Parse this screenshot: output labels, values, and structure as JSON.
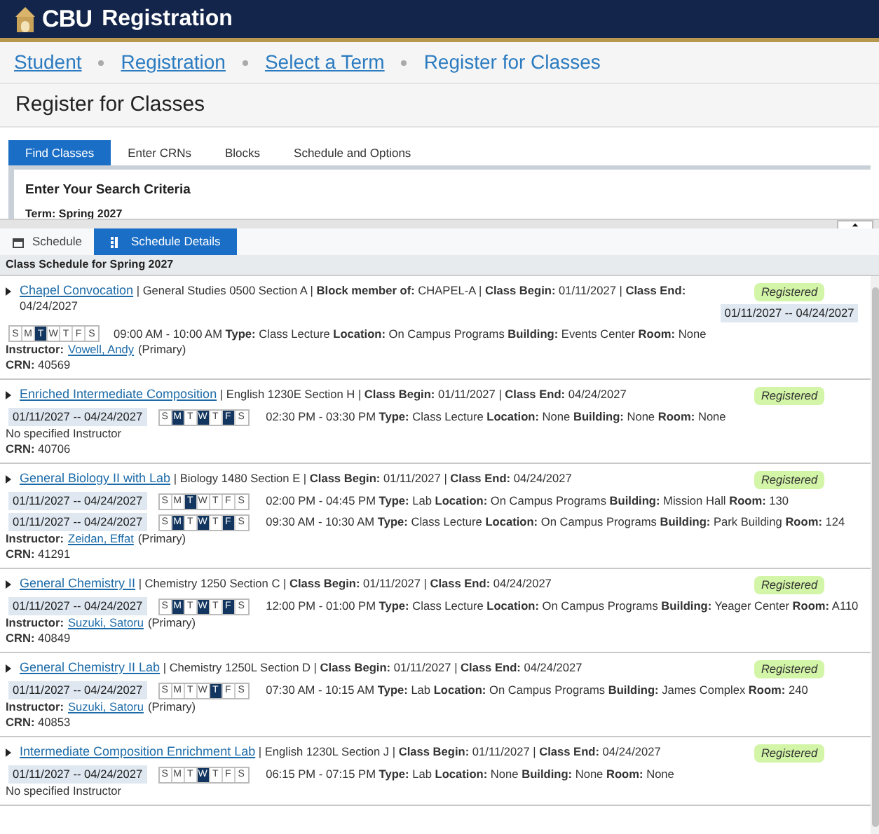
{
  "header": {
    "brand": "CBU",
    "title": "Registration"
  },
  "breadcrumbs": [
    {
      "label": "Student",
      "link": true
    },
    {
      "label": "Registration",
      "link": true
    },
    {
      "label": "Select a Term",
      "link": true
    },
    {
      "label": "Register for Classes",
      "link": false
    }
  ],
  "page_title": "Register for Classes",
  "tabs": [
    {
      "label": "Find Classes",
      "selected": true
    },
    {
      "label": "Enter CRNs",
      "selected": false
    },
    {
      "label": "Blocks",
      "selected": false
    },
    {
      "label": "Schedule and Options",
      "selected": false
    }
  ],
  "search_panel": {
    "heading": "Enter Your Search Criteria",
    "term": "Term: Spring 2027"
  },
  "bottom_tabs": [
    {
      "label": "Schedule",
      "kind": "calendar",
      "selected": false
    },
    {
      "label": "Schedule Details",
      "kind": "list",
      "selected": true
    }
  ],
  "schedule_heading": "Class Schedule for Spring 2027",
  "courses": [
    {
      "title": "Chapel Convocation",
      "info": "| General Studies 0500 Section A | **Block member of:** CHAPEL-A | **Class Begin:** 01/11/2027 | **Class End:** 04/24/2027",
      "status": "Registered",
      "meetings": [
        {
          "kind": "aside",
          "date_range": "01/11/2027 -- 04/24/2027",
          "days": [
            {
              "label": "S",
              "selected": false
            },
            {
              "label": "M",
              "selected": false
            },
            {
              "label": "T",
              "selected": true
            },
            {
              "label": "W",
              "selected": false
            },
            {
              "label": "T",
              "selected": false
            },
            {
              "label": "F",
              "selected": false
            },
            {
              "label": "S",
              "selected": false
            }
          ],
          "details": "09:00 AM - 10:00 AM **Type:** Class Lecture **Location:** On Campus Programs **Building:** Events Center **Room:** None"
        }
      ],
      "instructor": {
        "label": "Instructor:",
        "name": "Vowell, Andy",
        "role": "(Primary)"
      },
      "crn": "**CRN:** 40569"
    },
    {
      "title": "Enriched Intermediate Composition",
      "info": "| English 1230E Section H | **Class Begin:** 01/11/2027 | **Class End:** 04/24/2027",
      "status": "Registered",
      "meetings": [
        {
          "kind": "inline",
          "date_range": "01/11/2027 -- 04/24/2027",
          "days": [
            {
              "label": "S",
              "selected": false
            },
            {
              "label": "M",
              "selected": true
            },
            {
              "label": "T",
              "selected": false
            },
            {
              "label": "W",
              "selected": true
            },
            {
              "label": "T",
              "selected": false
            },
            {
              "label": "F",
              "selected": true
            },
            {
              "label": "S",
              "selected": false
            }
          ],
          "details": "02:30 PM - 03:30 PM **Type:** Class Lecture **Location:** None **Building:** None **Room:** None"
        }
      ],
      "instructor_note": "No specified Instructor",
      "crn": "**CRN:** 40706"
    },
    {
      "title": "General Biology II with Lab",
      "info": "| Biology 1480 Section E | **Class Begin:** 01/11/2027 | **Class End:** 04/24/2027",
      "status": "Registered",
      "meetings": [
        {
          "kind": "inline",
          "date_range": "01/11/2027 -- 04/24/2027",
          "days": [
            {
              "label": "S",
              "selected": false
            },
            {
              "label": "M",
              "selected": false
            },
            {
              "label": "T",
              "selected": true
            },
            {
              "label": "W",
              "selected": false
            },
            {
              "label": "T",
              "selected": false
            },
            {
              "label": "F",
              "selected": false
            },
            {
              "label": "S",
              "selected": false
            }
          ],
          "details": "02:00 PM - 04:45 PM **Type:** Lab **Location:** On Campus Programs **Building:** Mission Hall **Room:** 130"
        },
        {
          "kind": "inline",
          "date_range": "01/11/2027 -- 04/24/2027",
          "days": [
            {
              "label": "S",
              "selected": false
            },
            {
              "label": "M",
              "selected": true
            },
            {
              "label": "T",
              "selected": false
            },
            {
              "label": "W",
              "selected": true
            },
            {
              "label": "T",
              "selected": false
            },
            {
              "label": "F",
              "selected": true
            },
            {
              "label": "S",
              "selected": false
            }
          ],
          "details": "09:30 AM - 10:30 AM **Type:** Class Lecture **Location:** On Campus Programs **Building:** Park Building **Room:** 124"
        }
      ],
      "instructor": {
        "label": "Instructor:",
        "name": "Zeidan, Effat",
        "role": "(Primary)"
      },
      "crn": "**CRN:** 41291"
    },
    {
      "title": "General Chemistry II",
      "info": "| Chemistry 1250 Section C | **Class Begin:** 01/11/2027 | **Class End:** 04/24/2027",
      "status": "Registered",
      "meetings": [
        {
          "kind": "inline",
          "date_range": "01/11/2027 -- 04/24/2027",
          "days": [
            {
              "label": "S",
              "selected": false
            },
            {
              "label": "M",
              "selected": true
            },
            {
              "label": "T",
              "selected": false
            },
            {
              "label": "W",
              "selected": true
            },
            {
              "label": "T",
              "selected": false
            },
            {
              "label": "F",
              "selected": true
            },
            {
              "label": "S",
              "selected": false
            }
          ],
          "details": "12:00 PM - 01:00 PM **Type:** Class Lecture **Location:** On Campus Programs **Building:** Yeager Center **Room:** A110"
        }
      ],
      "instructor": {
        "label": "Instructor:",
        "name": "Suzuki, Satoru",
        "role": "(Primary)"
      },
      "crn": "**CRN:** 40849"
    },
    {
      "title": "General Chemistry II Lab",
      "info": "| Chemistry 1250L Section D | **Class Begin:** 01/11/2027 | **Class End:** 04/24/2027",
      "status": "Registered",
      "meetings": [
        {
          "kind": "inline",
          "date_range": "01/11/2027 -- 04/24/2027",
          "days": [
            {
              "label": "S",
              "selected": false
            },
            {
              "label": "M",
              "selected": false
            },
            {
              "label": "T",
              "selected": false
            },
            {
              "label": "W",
              "selected": false
            },
            {
              "label": "T",
              "selected": true
            },
            {
              "label": "F",
              "selected": false
            },
            {
              "label": "S",
              "selected": false
            }
          ],
          "details": "07:30 AM - 10:15 AM **Type:** Lab **Location:** On Campus Programs **Building:** James Complex **Room:** 240"
        }
      ],
      "instructor": {
        "label": "Instructor:",
        "name": "Suzuki, Satoru",
        "role": "(Primary)"
      },
      "crn": "**CRN:** 40853"
    },
    {
      "title": "Intermediate Composition Enrichment Lab",
      "info": "| English 1230L Section J | **Class Begin:** 01/11/2027 | **Class End:** 04/24/2027",
      "status": "Registered",
      "meetings": [
        {
          "kind": "inline",
          "date_range": "01/11/2027 -- 04/24/2027",
          "days": [
            {
              "label": "S",
              "selected": false
            },
            {
              "label": "M",
              "selected": false
            },
            {
              "label": "T",
              "selected": false
            },
            {
              "label": "W",
              "selected": true
            },
            {
              "label": "T",
              "selected": false
            },
            {
              "label": "F",
              "selected": false
            },
            {
              "label": "S",
              "selected": false
            }
          ],
          "details": "06:15 PM - 07:15 PM **Type:** Lab **Location:** None **Building:** None **Room:** None"
        }
      ],
      "instructor_note": "No specified Instructor"
    }
  ]
}
